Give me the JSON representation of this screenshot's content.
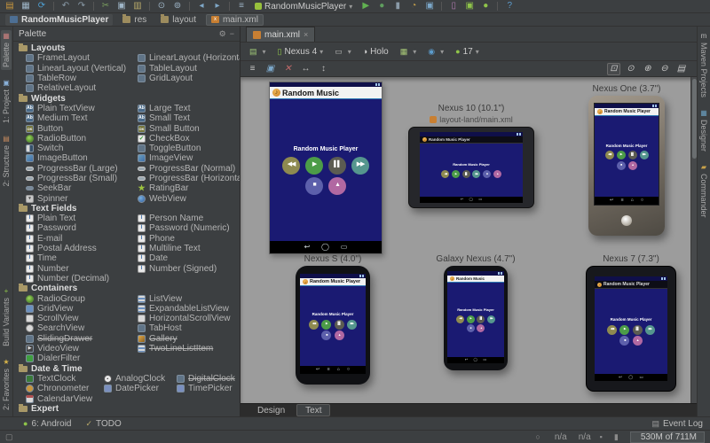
{
  "window": {
    "left_icons": [
      {
        "name": "open-icon",
        "glyph": "▤",
        "color": "#c9963e"
      },
      {
        "name": "save-icon",
        "glyph": "▦",
        "color": "#9fb6c8"
      },
      {
        "name": "sync-icon",
        "glyph": "⟳",
        "color": "#4e9fd1"
      },
      {
        "sep": true
      },
      {
        "name": "undo-icon",
        "glyph": "↶",
        "color": "#8a9ba8"
      },
      {
        "name": "redo-icon",
        "glyph": "↷",
        "color": "#8a9ba8"
      },
      {
        "sep": true
      },
      {
        "name": "cut-icon",
        "glyph": "✂",
        "color": "#7a9e5f"
      },
      {
        "name": "copy-icon",
        "glyph": "▣",
        "color": "#9fb6c8"
      },
      {
        "name": "paste-icon",
        "glyph": "▥",
        "color": "#b8a96a"
      },
      {
        "sep": true
      },
      {
        "name": "find-icon",
        "glyph": "⊙",
        "color": "#9fb6c8"
      },
      {
        "name": "replace-icon",
        "glyph": "⊚",
        "color": "#9fb6c8"
      },
      {
        "sep": true
      },
      {
        "name": "back-icon",
        "glyph": "◂",
        "color": "#7fa8c8"
      },
      {
        "name": "forward-icon",
        "glyph": "▸",
        "color": "#7fa8c8"
      },
      {
        "sep": true
      },
      {
        "name": "ddms-icon",
        "glyph": "≡",
        "color": "#9fb6c8"
      }
    ],
    "run_config": "RandomMusicPlayer",
    "right_icons": [
      {
        "name": "run-icon",
        "glyph": "▶",
        "color": "#61b151"
      },
      {
        "name": "debug-icon",
        "glyph": "●",
        "color": "#5f9e5f"
      },
      {
        "name": "coverage-icon",
        "glyph": "▮",
        "color": "#8a9ba8"
      },
      {
        "name": "attach-profiler-icon",
        "glyph": "◔",
        "color": "#c9a24a"
      },
      {
        "name": "monitor-icon",
        "glyph": "▣",
        "color": "#7ba7c9"
      },
      {
        "sep": true
      },
      {
        "name": "device-monitor-icon",
        "glyph": "▯",
        "color": "#b07ab0"
      },
      {
        "name": "avd-manager-icon",
        "glyph": "▣",
        "color": "#8fc44a"
      },
      {
        "name": "sdk-manager-icon",
        "glyph": "●",
        "color": "#8fc44a"
      },
      {
        "sep": true
      },
      {
        "name": "help-icon",
        "glyph": "?",
        "color": "#5c9ccc"
      }
    ]
  },
  "breadcrumbs": [
    {
      "icon": "project",
      "label": "RandomMusicPlayer",
      "bold": true
    },
    {
      "icon": "folder",
      "label": "res"
    },
    {
      "icon": "folder",
      "label": "layout"
    },
    {
      "icon": "xml",
      "label": "main.xml",
      "active": true
    }
  ],
  "left_stripe": {
    "top": [
      {
        "label": "Palette",
        "glyph": "▦",
        "color": "#c9807f",
        "selected": true
      },
      {
        "label": "1: Project",
        "glyph": "▣",
        "color": "#89b0d8"
      },
      {
        "label": "2: Structure",
        "glyph": "▤",
        "color": "#c98b5f"
      }
    ],
    "bottom": [
      {
        "label": "Build Variants",
        "glyph": "+",
        "color": "#8fc44a"
      },
      {
        "label": "2: Favorites",
        "glyph": "★",
        "color": "#d8b44a"
      }
    ]
  },
  "right_stripe": [
    {
      "label": "Maven Projects",
      "glyph": "m",
      "color": "#b8b8b8"
    },
    {
      "label": "Designer",
      "glyph": "▦",
      "color": "#6a9ebf"
    },
    {
      "label": "Commander",
      "glyph": "▰",
      "color": "#c9a24a"
    }
  ],
  "palette": {
    "title": "Palette",
    "gear_icon": "⚙",
    "hide_icon": "−",
    "sections": [
      {
        "label": "Layouts",
        "cols": 2,
        "items": [
          {
            "label": "FrameLayout",
            "icon": "lay"
          },
          {
            "label": "LinearLayout (Horizontal)",
            "icon": "lay"
          },
          {
            "label": "LinearLayout (Vertical)",
            "icon": "lay"
          },
          {
            "label": "TableLayout",
            "icon": "lay"
          },
          {
            "label": "TableRow",
            "icon": "lay"
          },
          {
            "label": "GridLayout",
            "icon": "lay"
          },
          {
            "label": "RelativeLayout",
            "icon": "lay"
          }
        ]
      },
      {
        "label": "Widgets",
        "cols": 2,
        "items": [
          {
            "label": "Plain TextView",
            "icon": "ab"
          },
          {
            "label": "Large Text",
            "icon": "ab"
          },
          {
            "label": "Medium Text",
            "icon": "ab"
          },
          {
            "label": "Small Text",
            "icon": "ab"
          },
          {
            "label": "Button",
            "icon": "ok"
          },
          {
            "label": "Small Button",
            "icon": "ok"
          },
          {
            "label": "RadioButton",
            "icon": "radio"
          },
          {
            "label": "CheckBox",
            "icon": "check"
          },
          {
            "label": "Switch",
            "icon": "sw"
          },
          {
            "label": "ToggleButton",
            "icon": "tg"
          },
          {
            "label": "ImageButton",
            "icon": "img"
          },
          {
            "label": "ImageView",
            "icon": "img"
          },
          {
            "label": "ProgressBar (Large)",
            "icon": "prog"
          },
          {
            "label": "ProgressBar (Normal)",
            "icon": "prog"
          },
          {
            "label": "ProgressBar (Small)",
            "icon": "prog"
          },
          {
            "label": "ProgressBar (Horizontal)",
            "icon": "prog"
          },
          {
            "label": "SeekBar",
            "icon": "seek"
          },
          {
            "label": "RatingBar",
            "icon": "star"
          },
          {
            "label": "Spinner",
            "icon": "spin"
          },
          {
            "label": "WebView",
            "icon": "web"
          }
        ]
      },
      {
        "label": "Text Fields",
        "cols": 2,
        "items": [
          {
            "label": "Plain Text",
            "icon": "tf"
          },
          {
            "label": "Person Name",
            "icon": "tf"
          },
          {
            "label": "Password",
            "icon": "tf"
          },
          {
            "label": "Password (Numeric)",
            "icon": "tf"
          },
          {
            "label": "E-mail",
            "icon": "tf"
          },
          {
            "label": "Phone",
            "icon": "tf"
          },
          {
            "label": "Postal Address",
            "icon": "tf"
          },
          {
            "label": "Multiline Text",
            "icon": "tf"
          },
          {
            "label": "Time",
            "icon": "tf"
          },
          {
            "label": "Date",
            "icon": "tf"
          },
          {
            "label": "Number",
            "icon": "tf"
          },
          {
            "label": "Number (Signed)",
            "icon": "tf"
          },
          {
            "label": "Number (Decimal)",
            "icon": "tf"
          }
        ]
      },
      {
        "label": "Containers",
        "cols": 2,
        "items": [
          {
            "label": "RadioGroup",
            "icon": "radio2"
          },
          {
            "label": "ListView",
            "icon": "list"
          },
          {
            "label": "GridView",
            "icon": "grid"
          },
          {
            "label": "ExpandableListView",
            "icon": "list"
          },
          {
            "label": "ScrollView",
            "icon": "scroll"
          },
          {
            "label": "HorizontalScrollView",
            "icon": "scroll"
          },
          {
            "label": "SearchView",
            "icon": "searchv"
          },
          {
            "label": "TabHost",
            "icon": "tabh"
          },
          {
            "label": "SlidingDrawer",
            "icon": "slide",
            "deprecated": true
          },
          {
            "label": "Gallery",
            "icon": "gallery",
            "deprecated": true
          },
          {
            "label": "VideoView",
            "icon": "video"
          },
          {
            "label": "TwoLineListItem",
            "icon": "list",
            "deprecated": true
          },
          {
            "label": "DialerFilter",
            "icon": "dialer"
          }
        ]
      },
      {
        "label": "Date & Time",
        "cols": 3,
        "items": [
          {
            "label": "TextClock",
            "icon": "tclock"
          },
          {
            "label": "AnalogClock",
            "icon": "aclock"
          },
          {
            "label": "DigitalClock",
            "icon": "dclock",
            "deprecated": true
          },
          {
            "label": "Chronometer",
            "icon": "chrono"
          },
          {
            "label": "DatePicker",
            "icon": "dpick"
          },
          {
            "label": "TimePicker",
            "icon": "tpick"
          },
          {
            "label": "CalendarView",
            "icon": "cal"
          }
        ]
      },
      {
        "label": "Expert",
        "cols": 2,
        "items": []
      }
    ]
  },
  "editor": {
    "tab": {
      "label": "main.xml",
      "close": "×"
    },
    "config_toolbar": [
      {
        "name": "configuration-dropdown",
        "glyph": "▤",
        "color": "#a0c878",
        "label": "",
        "caret": true
      },
      {
        "name": "device-dropdown",
        "glyph": "▯",
        "color": "#8fc44a",
        "label": "Nexus 4",
        "caret": true
      },
      {
        "name": "orientation-dropdown",
        "glyph": "▭",
        "color": "#b8b8b8",
        "label": "",
        "caret": true
      },
      {
        "name": "theme-dropdown",
        "glyph": "◑",
        "color": "#d8d8d8",
        "label": "Holo",
        "caret": false
      },
      {
        "name": "activity-dropdown",
        "glyph": "▦",
        "color": "#a8c878",
        "label": "",
        "caret": true
      },
      {
        "name": "locale-dropdown",
        "glyph": "◉",
        "color": "#5c9ccc",
        "label": "",
        "caret": true
      },
      {
        "name": "api-level-dropdown",
        "glyph": "●",
        "color": "#8fc44a",
        "label": "17",
        "caret": true
      }
    ],
    "view_toolbar_left": [
      {
        "name": "show-lint-icon",
        "glyph": "≡",
        "color": "#c8c8c8"
      },
      {
        "name": "preview-config-icon",
        "glyph": "▣",
        "color": "#7ba7c9"
      },
      {
        "name": "remove-config-icon",
        "glyph": "✕",
        "color": "#c46a6a"
      },
      {
        "name": "fit-width-icon",
        "glyph": "↔",
        "color": "#b8b8b8"
      },
      {
        "name": "fit-height-icon",
        "glyph": "↕",
        "color": "#b8b8b8"
      }
    ],
    "view_toolbar_right": [
      {
        "name": "zoom-fit-icon",
        "glyph": "⊡",
        "color": "#c8c8c8",
        "selected": true
      },
      {
        "name": "zoom-actual-icon",
        "glyph": "⊙",
        "color": "#c8c8c8"
      },
      {
        "name": "zoom-in-icon",
        "glyph": "⊕",
        "color": "#c8c8c8"
      },
      {
        "name": "zoom-out-icon",
        "glyph": "⊖",
        "color": "#c8c8c8"
      },
      {
        "name": "page-fit-icon",
        "glyph": "▤",
        "color": "#c8c8c8"
      }
    ],
    "previews": [
      {
        "kind": "main",
        "label": "",
        "title": "Random Music",
        "body": "Random Music Player",
        "bar": "light",
        "rows": [
          [
            {
              "g": "◀◀",
              "c": "#8e8a50"
            },
            {
              "g": "▶",
              "c": "#4c9c48"
            },
            {
              "g": "▌▌",
              "c": "#5c5c52"
            },
            {
              "g": "▶▶",
              "c": "#55968e"
            }
          ],
          [
            {
              "g": "■",
              "c": "#5d60ab"
            },
            {
              "g": "▲",
              "c": "#b168a2"
            }
          ]
        ],
        "nav": [
          "↩",
          "◯",
          "▭"
        ]
      },
      {
        "kind": "n10",
        "label": "Nexus 10 (10.1\")",
        "sub": "layout-land/main.xml",
        "title": "Random Music Player",
        "body": "Random Music Player",
        "bar": "dark",
        "rows": [
          [
            {
              "g": "◀◀",
              "c": "#8e8a50"
            },
            {
              "g": "▶",
              "c": "#4c9c48"
            },
            {
              "g": "▌▌",
              "c": "#5c5c52"
            },
            {
              "g": "▶▶",
              "c": "#55968e"
            },
            {
              "g": "■",
              "c": "#5d60ab"
            },
            {
              "g": "▲",
              "c": "#b168a2"
            }
          ]
        ],
        "nav": [
          "↩",
          "◯",
          "▭"
        ]
      },
      {
        "kind": "n1",
        "label": "Nexus One (3.7\")",
        "title": "Random Music Player",
        "body": "Random Music Player",
        "bar": "light",
        "rows": [
          [
            {
              "g": "◀◀",
              "c": "#8e8a50"
            },
            {
              "g": "▶",
              "c": "#4c9c48"
            },
            {
              "g": "▌▌",
              "c": "#5c5c52"
            },
            {
              "g": "▶▶",
              "c": "#55968e"
            }
          ],
          [
            {
              "g": "■",
              "c": "#5d60ab"
            },
            {
              "g": "▲",
              "c": "#b168a2"
            }
          ]
        ],
        "nav": [
          "↩",
          "≡",
          "⌂",
          "○"
        ]
      },
      {
        "kind": "ns",
        "label": "Nexus S (4.0\")",
        "title": "Random Music Player",
        "body": "Random Music Player",
        "bar": "light",
        "rows": [
          [
            {
              "g": "◀◀",
              "c": "#8e8a50"
            },
            {
              "g": "▶",
              "c": "#4c9c48"
            },
            {
              "g": "▌▌",
              "c": "#5c5c52"
            },
            {
              "g": "▶▶",
              "c": "#55968e"
            }
          ],
          [
            {
              "g": "■",
              "c": "#5d60ab"
            },
            {
              "g": "▲",
              "c": "#b168a2"
            }
          ]
        ],
        "nav": [
          "↩",
          "≡",
          "⌂",
          "○"
        ]
      },
      {
        "kind": "gn",
        "label": "Galaxy Nexus (4.7\")",
        "title": "Random Music",
        "body": "Random Music Player",
        "bar": "light",
        "rows": [
          [
            {
              "g": "◀◀",
              "c": "#8e8a50"
            },
            {
              "g": "▶",
              "c": "#4c9c48"
            },
            {
              "g": "▌▌",
              "c": "#5c5c52"
            },
            {
              "g": "▶▶",
              "c": "#55968e"
            }
          ],
          [
            {
              "g": "■",
              "c": "#5d60ab"
            },
            {
              "g": "▲",
              "c": "#b168a2"
            }
          ]
        ],
        "nav": [
          "↩",
          "◯",
          "▭"
        ]
      },
      {
        "kind": "n7",
        "label": "Nexus 7 (7.3\")",
        "title": "Random Music Player",
        "body": "Random Music Player",
        "bar": "dark",
        "rows": [
          [
            {
              "g": "◀◀",
              "c": "#8e8a50"
            },
            {
              "g": "▶",
              "c": "#4c9c48"
            },
            {
              "g": "▌▌",
              "c": "#5c5c52"
            },
            {
              "g": "▶▶",
              "c": "#55968e"
            }
          ],
          [
            {
              "g": "■",
              "c": "#5d60ab"
            },
            {
              "g": "▲",
              "c": "#b168a2"
            }
          ]
        ],
        "nav": [
          "↩",
          "◯",
          "▭"
        ]
      }
    ],
    "bottom_tabs": [
      {
        "label": "Design"
      },
      {
        "label": "Text",
        "boxed": true
      }
    ]
  },
  "bottom_bar": {
    "left": [
      {
        "name": "android-tool-window",
        "glyph": "●",
        "color": "#8fc44a",
        "label": "6: Android"
      },
      {
        "name": "todo-tool-window",
        "glyph": "✓",
        "color": "#b8a96a",
        "label": "TODO"
      }
    ],
    "right": [
      {
        "name": "event-log",
        "glyph": "▤",
        "color": "#9a9a9a",
        "label": "Event Log"
      }
    ]
  },
  "status_bar": {
    "toggle_glyph": "▢",
    "items": [
      {
        "name": "background-tasks-icon",
        "glyph": "○"
      },
      {
        "name": "position-indicator",
        "text": "n/a"
      },
      {
        "name": "line-separator-indicator",
        "text": "n/a"
      },
      {
        "name": "lock-icon",
        "glyph": "▪"
      },
      {
        "name": "hector-icon",
        "glyph": "▮"
      },
      {
        "name": "memory-indicator",
        "text": "530M of 711M",
        "box": true
      }
    ]
  }
}
